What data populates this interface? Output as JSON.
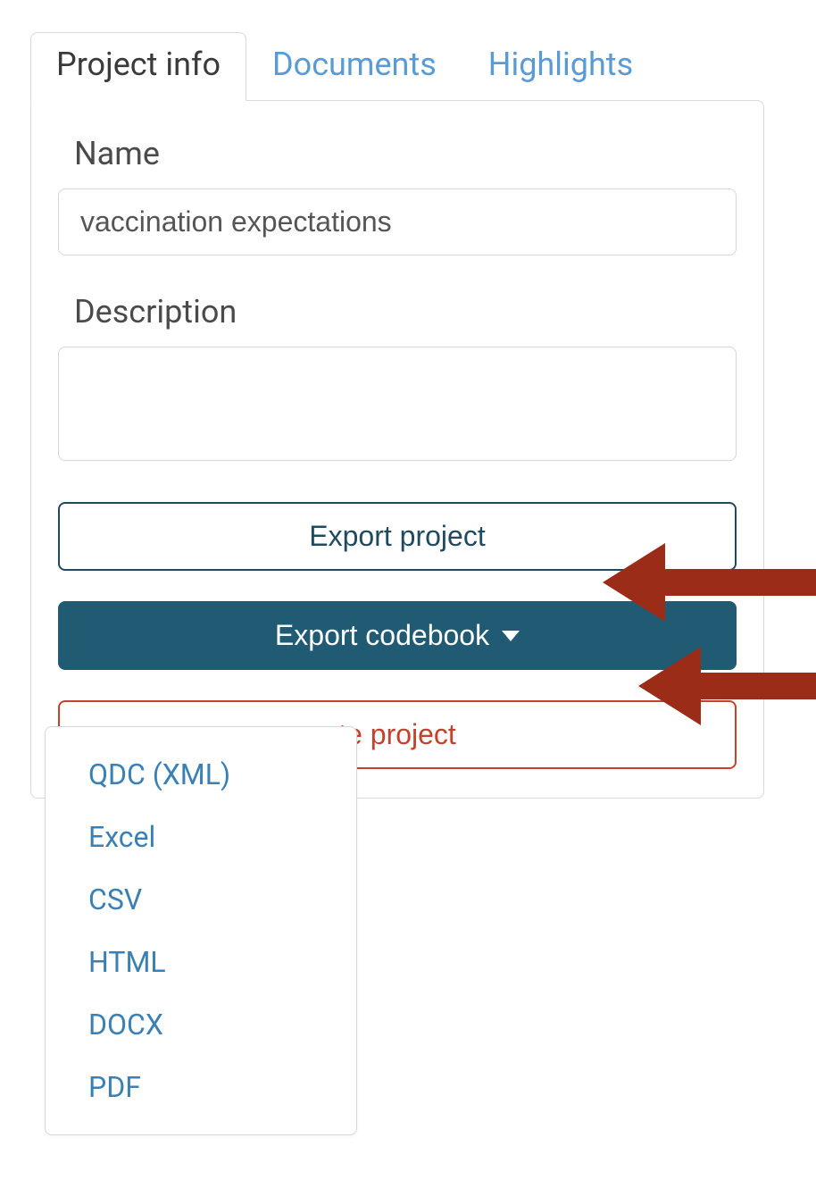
{
  "tabs": {
    "project_info": "Project info",
    "documents": "Documents",
    "highlights": "Highlights"
  },
  "form": {
    "name_label": "Name",
    "name_value": "vaccination expectations",
    "description_label": "Description",
    "description_value": ""
  },
  "buttons": {
    "export_project": "Export project",
    "export_codebook": "Export codebook",
    "delete_project": "te project"
  },
  "dropdown": {
    "items": [
      "QDC (XML)",
      "Excel",
      "CSV",
      "HTML",
      "DOCX",
      "PDF"
    ]
  },
  "colors": {
    "link": "#5b9bd5",
    "primary_dark": "#205a73",
    "danger": "#c5412c",
    "arrow": "#9b2d18"
  }
}
